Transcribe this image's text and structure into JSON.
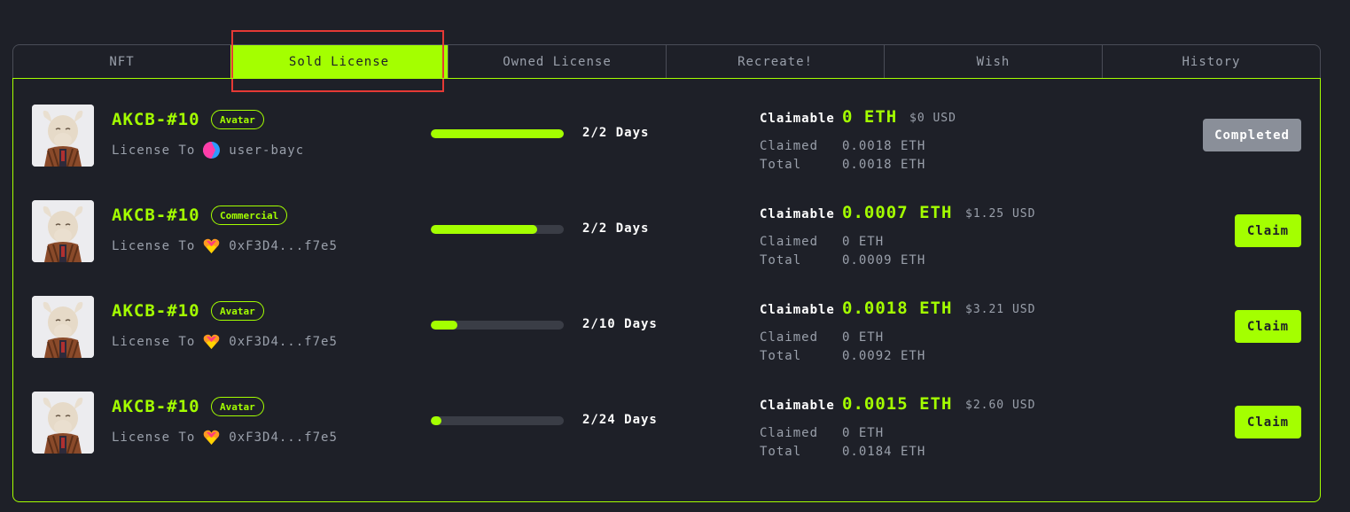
{
  "tabs": [
    {
      "label": "NFT",
      "active": false
    },
    {
      "label": "Sold License",
      "active": true
    },
    {
      "label": "Owned License",
      "active": false
    },
    {
      "label": "Recreate!",
      "active": false
    },
    {
      "label": "Wish",
      "active": false
    },
    {
      "label": "History",
      "active": false
    }
  ],
  "rows": [
    {
      "title": "AKCB-#10",
      "badge": "Avatar",
      "license_prefix": "License To",
      "license_to": "user-bayc",
      "license_icon": "pink-blue-avatar-icon",
      "progress": 1.0,
      "days": "2/2 Days",
      "claimable_label": "Claimable",
      "claimable_amount": "0 ETH",
      "claimable_usd": "$0 USD",
      "claimed_label": "Claimed",
      "claimed_value": "0.0018 ETH",
      "total_label": "Total",
      "total_value": "0.0018 ETH",
      "action": "Completed"
    },
    {
      "title": "AKCB-#10",
      "badge": "Commercial",
      "license_prefix": "License To",
      "license_to": "0xF3D4...f7e5",
      "license_icon": "colorful-heart-icon",
      "progress": 0.8,
      "days": "2/2 Days",
      "claimable_label": "Claimable",
      "claimable_amount": "0.0007 ETH",
      "claimable_usd": "$1.25 USD",
      "claimed_label": "Claimed",
      "claimed_value": "0 ETH",
      "total_label": "Total",
      "total_value": "0.0009 ETH",
      "action": "Claim"
    },
    {
      "title": "AKCB-#10",
      "badge": "Avatar",
      "license_prefix": "License To",
      "license_to": "0xF3D4...f7e5",
      "license_icon": "colorful-heart-icon",
      "progress": 0.2,
      "days": "2/10 Days",
      "claimable_label": "Claimable",
      "claimable_amount": "0.0018 ETH",
      "claimable_usd": "$3.21 USD",
      "claimed_label": "Claimed",
      "claimed_value": "0 ETH",
      "total_label": "Total",
      "total_value": "0.0092 ETH",
      "action": "Claim"
    },
    {
      "title": "AKCB-#10",
      "badge": "Avatar",
      "license_prefix": "License To",
      "license_to": "0xF3D4...f7e5",
      "license_icon": "colorful-heart-icon",
      "progress": 0.083,
      "days": "2/24 Days",
      "claimable_label": "Claimable",
      "claimable_amount": "0.0015 ETH",
      "claimable_usd": "$2.60 USD",
      "claimed_label": "Claimed",
      "claimed_value": "0 ETH",
      "total_label": "Total",
      "total_value": "0.0184 ETH",
      "action": "Claim"
    }
  ],
  "colors": {
    "background": "#1e2028",
    "accent": "#a4ff00",
    "muted_text": "#9aa0ab",
    "completed_button": "#8a8f99",
    "highlight_box": "#e53935"
  }
}
